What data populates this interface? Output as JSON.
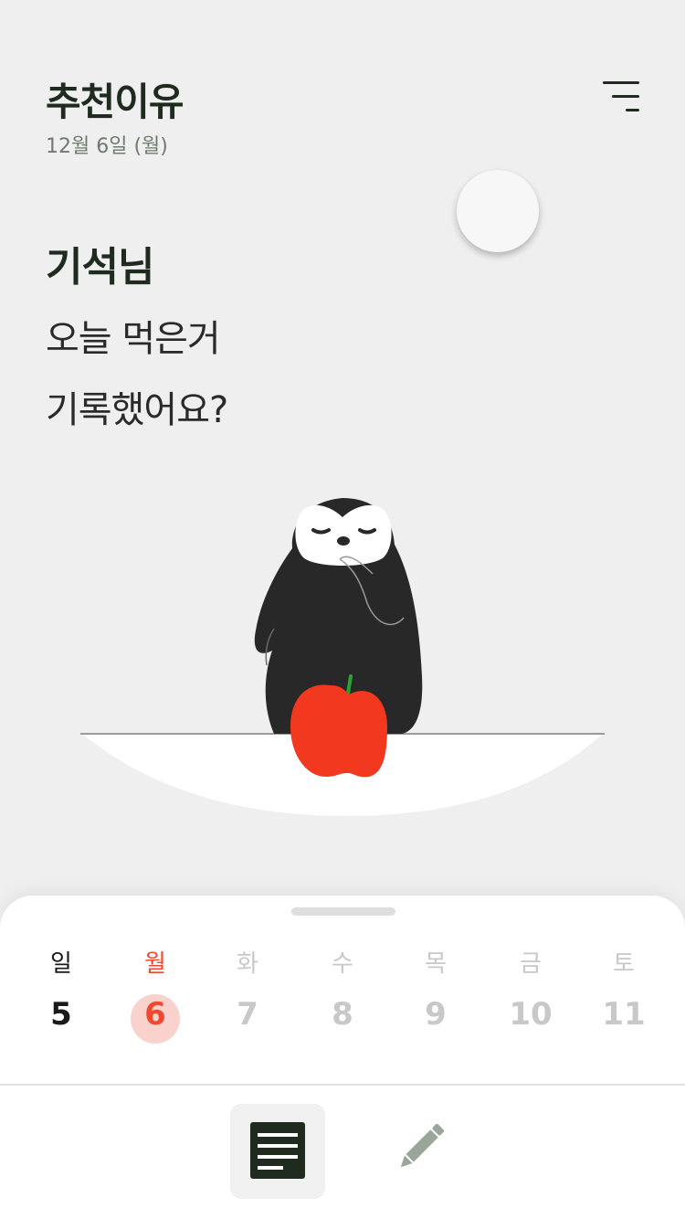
{
  "header": {
    "title": "추천이유",
    "date": "12월 6일 (월)",
    "menu_icon": "menu-icon"
  },
  "greeting": {
    "name": "기석님",
    "line1": "오늘 먹은거",
    "line2": "기록했어요?"
  },
  "illustration": {
    "character": "penguin",
    "food": "apple",
    "colors": {
      "penguin": "#272827",
      "apple": "#f2381e",
      "stem": "#2aa334",
      "plate": "#ffffff"
    }
  },
  "week": {
    "days": [
      {
        "weekday": "일",
        "date": "5",
        "state": "past"
      },
      {
        "weekday": "월",
        "date": "6",
        "state": "today"
      },
      {
        "weekday": "화",
        "date": "7",
        "state": "future"
      },
      {
        "weekday": "수",
        "date": "8",
        "state": "future"
      },
      {
        "weekday": "목",
        "date": "9",
        "state": "future"
      },
      {
        "weekday": "금",
        "date": "10",
        "state": "future"
      },
      {
        "weekday": "토",
        "date": "11",
        "state": "future"
      }
    ],
    "colors": {
      "past": "#1a1a1a",
      "today": "#f0492f",
      "future": "#c8c8c8",
      "today_bg": "#f9d2cd"
    }
  },
  "bottom_nav": {
    "items": [
      {
        "icon": "list-icon",
        "selected": true
      },
      {
        "icon": "pencil-icon",
        "selected": false
      }
    ]
  },
  "colors": {
    "background": "#efefef",
    "title": "#1f2b1f",
    "accent": "#f0492f"
  }
}
